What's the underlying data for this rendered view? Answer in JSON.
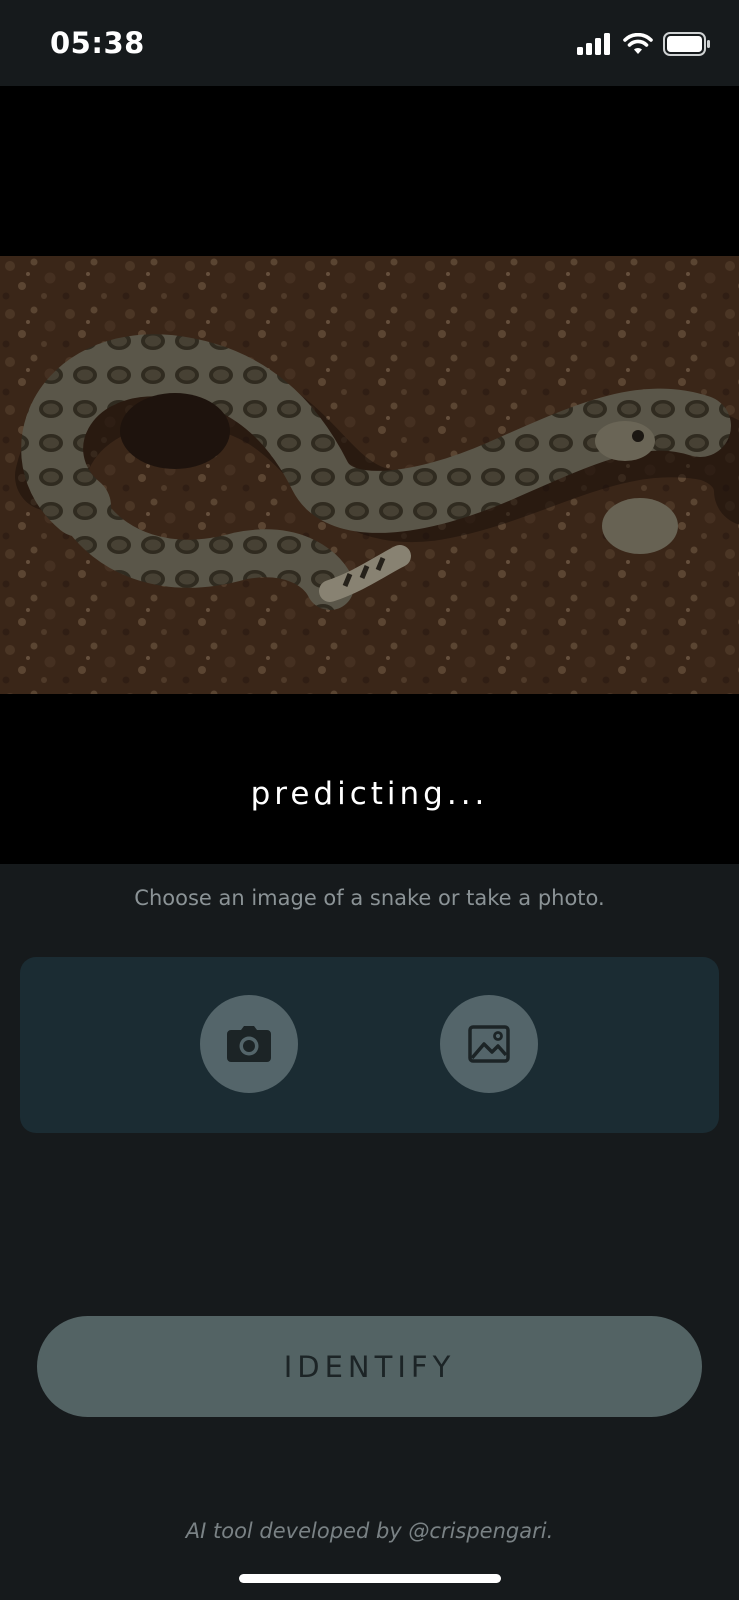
{
  "status_bar": {
    "time": "05:38",
    "icons": [
      "signal-icon",
      "wifi-icon",
      "battery-icon"
    ]
  },
  "preview": {
    "image": "rattlesnake-on-gravel",
    "status_text": "predicting..."
  },
  "instruction": "Choose an image of a snake or take a photo.",
  "picker": {
    "camera_icon": "camera-icon",
    "gallery_icon": "image-gallery-icon"
  },
  "identify_label": "IDENTIFY",
  "footer": "AI tool developed by @crispengari.",
  "colors": {
    "background": "#161a1c",
    "card": "#1b2c33",
    "button": "#536364",
    "picker_button": "#54656a"
  }
}
